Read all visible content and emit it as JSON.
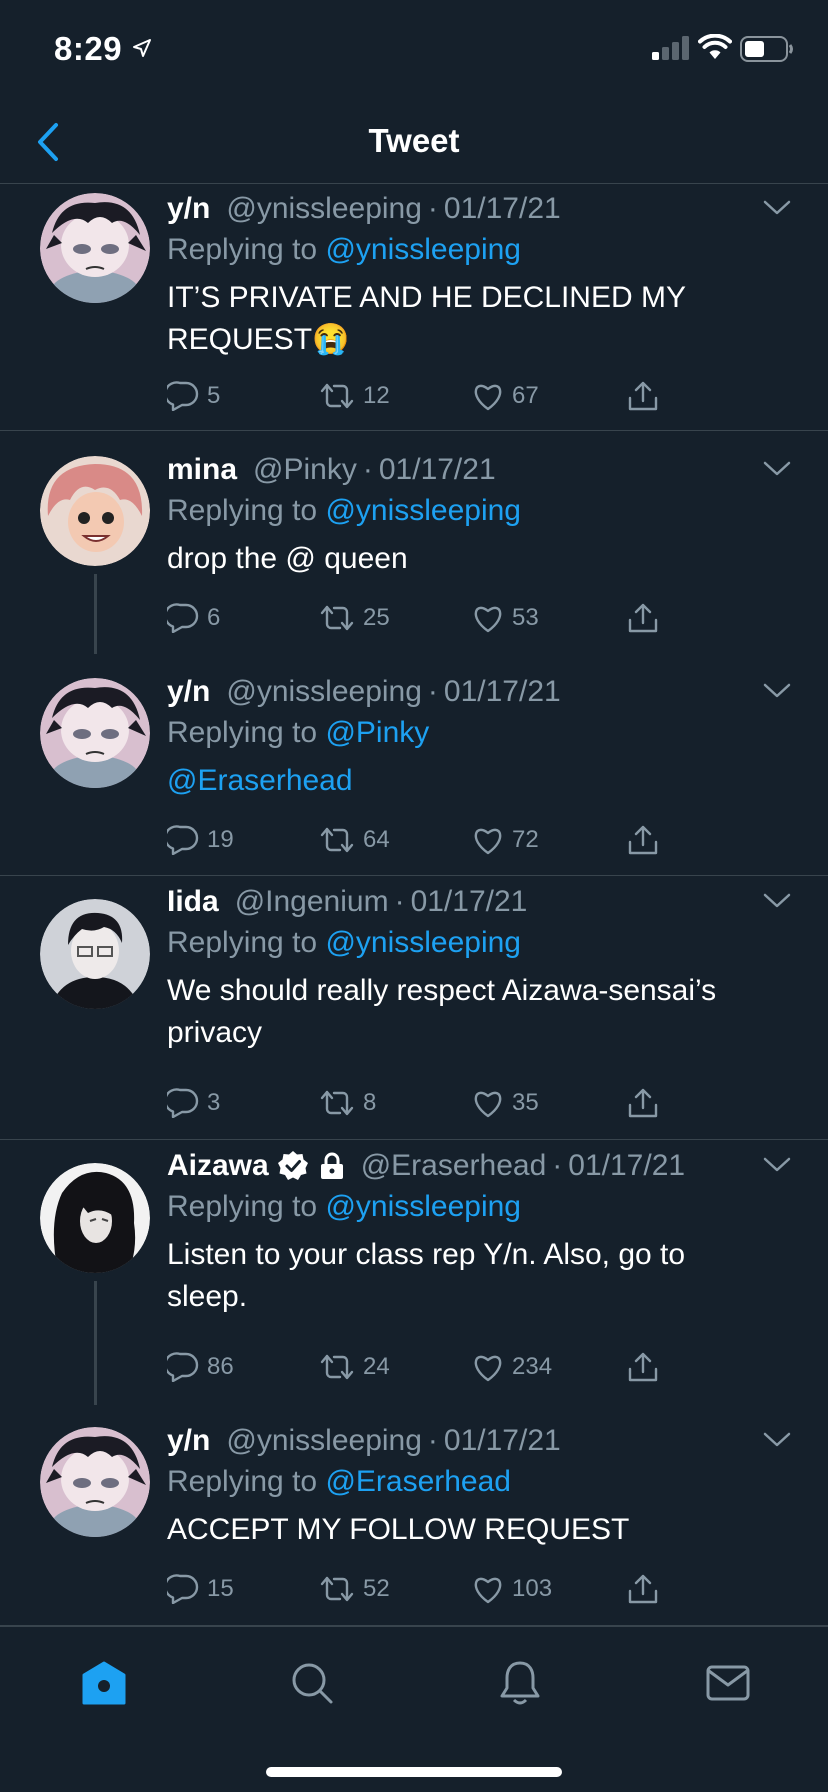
{
  "status_bar": {
    "time": "8:29"
  },
  "nav": {
    "title": "Tweet"
  },
  "tweets": [
    {
      "name": "y/n",
      "handle": "@ynissleeping",
      "date": "01/17/21",
      "reply_prefix": "Replying to",
      "reply_to": "@ynissleeping",
      "text": "IT’S PRIVATE AND HE DECLINED MY REQUEST😭",
      "replies": "5",
      "retweets": "12",
      "likes": "67"
    },
    {
      "name": "mina",
      "handle": "@Pinky",
      "date": "01/17/21",
      "reply_prefix": "Replying to",
      "reply_to": "@ynissleeping",
      "text": "drop the @ queen",
      "replies": "6",
      "retweets": "25",
      "likes": "53"
    },
    {
      "name": "y/n",
      "handle": "@ynissleeping",
      "date": "01/17/21",
      "reply_prefix": "Replying to",
      "reply_to": "@Pinky",
      "text": "@Eraserhead",
      "replies": "19",
      "retweets": "64",
      "likes": "72"
    },
    {
      "name": "Iida",
      "handle": "@Ingenium",
      "date": "01/17/21",
      "reply_prefix": "Replying to",
      "reply_to": "@ynissleeping",
      "text": "We should really respect Aizawa-sensai’s privacy",
      "replies": "3",
      "retweets": "8",
      "likes": "35"
    },
    {
      "name": "Aizawa",
      "handle": "@Eraserhead",
      "date": "01/17/21",
      "reply_prefix": "Replying to",
      "reply_to": "@ynissleeping",
      "text": "Listen to your class rep Y/n. Also, go to sleep.",
      "replies": "86",
      "retweets": "24",
      "likes": "234"
    },
    {
      "name": "y/n",
      "handle": "@ynissleeping",
      "date": "01/17/21",
      "reply_prefix": "Replying to",
      "reply_to": "@Eraserhead",
      "text": "ACCEPT MY FOLLOW REQUEST",
      "replies": "15",
      "retweets": "52",
      "likes": "103"
    }
  ],
  "tabs": [
    "home-icon",
    "search-icon",
    "notifications-icon",
    "messages-icon"
  ],
  "colors": {
    "background": "#15202b",
    "accent": "#1da1f2",
    "muted": "#8899a6",
    "divider": "#38444d"
  }
}
